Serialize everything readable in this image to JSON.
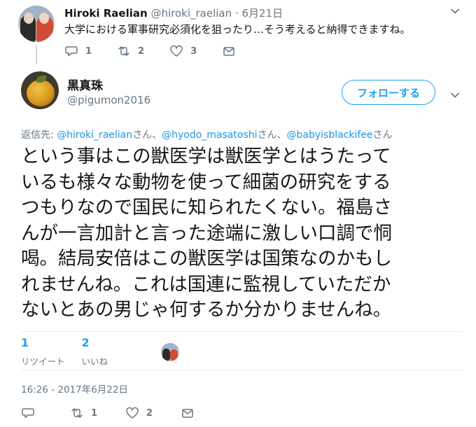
{
  "context_tweet": {
    "author_name": "Hiroki Raelian",
    "handle": "@hiroki_raelian",
    "separator": "·",
    "date": "6月21日",
    "text": "大学における軍事研究必須化を狙ったり…そう考えると納得できますね。",
    "actions": {
      "reply_count": "1",
      "retweet_count": "2",
      "like_count": "3"
    }
  },
  "main_tweet": {
    "author_name": "黒真珠",
    "handle": "@pigumon2016",
    "follow_label": "フォローする",
    "replying_to": {
      "prefix": "返信先:",
      "mentions": [
        {
          "handle": "@hiroki_raelian",
          "suffix": "さん、"
        },
        {
          "handle": "@hyodo_masatoshi",
          "suffix": "さん、"
        },
        {
          "handle": "@babyisblackifee",
          "suffix": "さん"
        }
      ]
    },
    "text_lines": [
      "という事はこの獣医学は獣医学とはうたって",
      "いるも様々な動物を使って細菌の研究をする",
      "つもりなので国民に知られたくない。福島さ",
      "んが一言加計と言った途端に激しい口調で恫",
      "喝。結局安倍はこの獣医学は国策なのかもし",
      "れませんね。これは国連に監視していただか",
      "ないとあの男じゃ何するか分かりませんね。"
    ],
    "stats": {
      "retweets": {
        "count": "1",
        "label": "リツイート"
      },
      "likes": {
        "count": "2",
        "label": "いいね"
      }
    },
    "timestamp": "16:26 - 2017年6月22日",
    "actions": {
      "reply_count": "",
      "retweet_count": "1",
      "like_count": "2"
    }
  },
  "colors": {
    "accent": "#1da1f2",
    "mention": "#1b95e0",
    "secondary_text": "#657786",
    "primary_text": "#14171a",
    "divider": "#e6ecf0"
  },
  "icons": [
    "reply-icon",
    "retweet-icon",
    "like-icon",
    "direct-message-icon",
    "chevron-down-icon"
  ]
}
